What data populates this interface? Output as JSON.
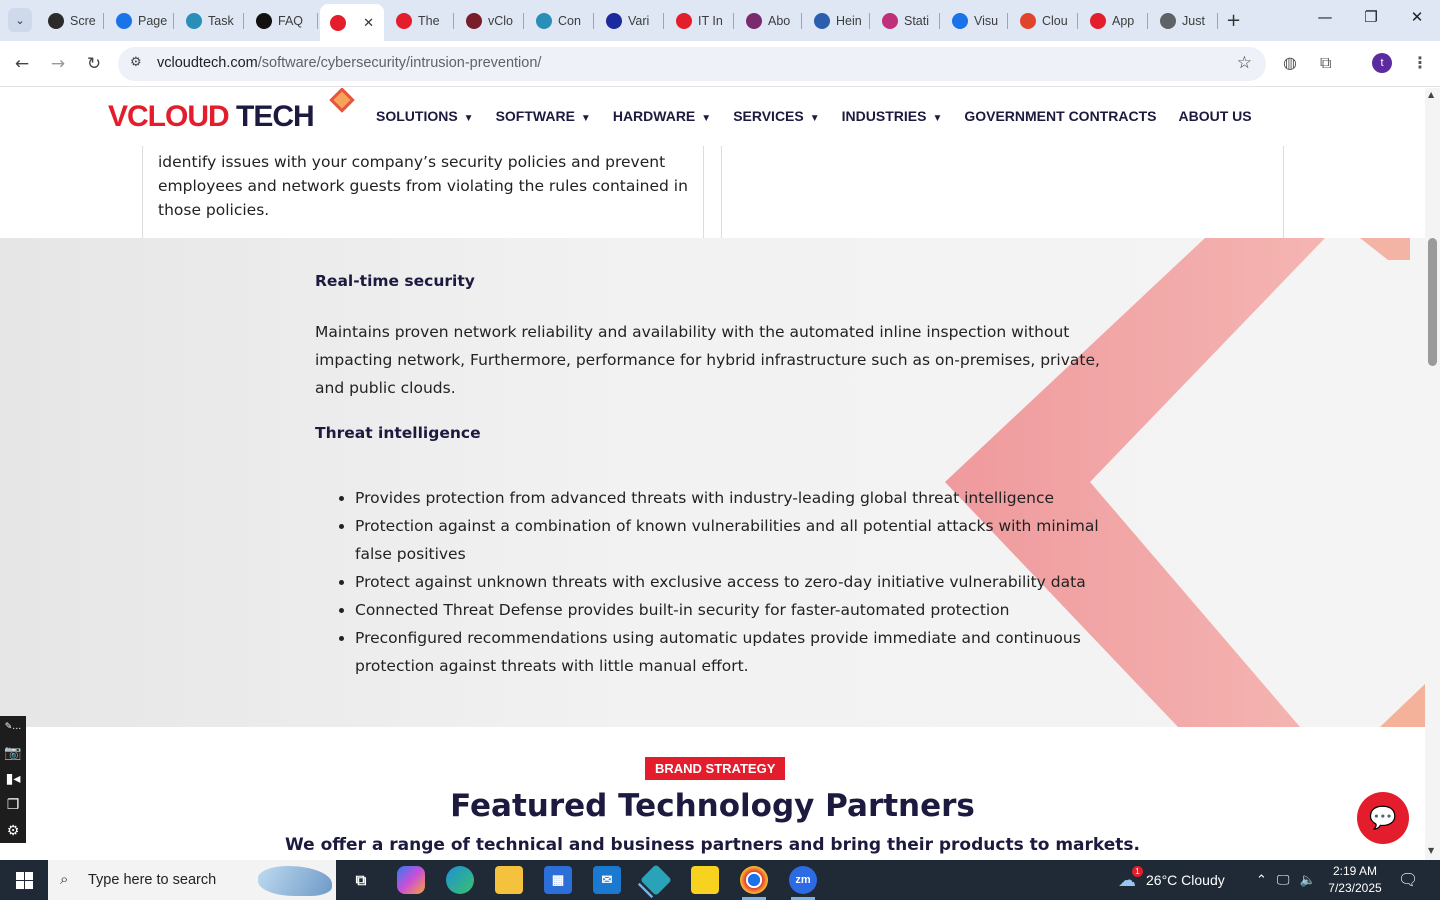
{
  "browser": {
    "tabs": [
      {
        "title": "Scre",
        "fav_color": "#2b2b2b",
        "icon": "screen-recorder-icon"
      },
      {
        "title": "Page",
        "fav_color": "#1a73e8",
        "icon": "gauge-icon"
      },
      {
        "title": "Task",
        "fav_color": "#2a8fb8",
        "icon": "hexagon-icon"
      },
      {
        "title": "FAQ",
        "fav_color": "#111111",
        "icon": "openai-icon"
      },
      {
        "title": "",
        "fav_color": "#e31d2b",
        "icon": "vcloud-icon",
        "active": true
      },
      {
        "title": "The",
        "fav_color": "#e31d2b",
        "icon": "vcloud-icon"
      },
      {
        "title": "vClo",
        "fav_color": "#7a1d2b",
        "icon": "v-icon"
      },
      {
        "title": "Con",
        "fav_color": "#2a8fb8",
        "icon": "hexagon-icon"
      },
      {
        "title": "Vari",
        "fav_color": "#1b2a9c",
        "icon": "x-icon"
      },
      {
        "title": "IT In",
        "fav_color": "#e31d2b",
        "icon": "vcloud-icon"
      },
      {
        "title": "Abo",
        "fav_color": "#7a2b6e",
        "icon": "circle-icon"
      },
      {
        "title": "Hein",
        "fav_color": "#2b5fae",
        "icon": "scale-icon"
      },
      {
        "title": "Stati",
        "fav_color": "#c0307a",
        "icon": "pen-icon"
      },
      {
        "title": "Visu",
        "fav_color": "#1a73e8",
        "icon": "pulse-icon"
      },
      {
        "title": "Clou",
        "fav_color": "#e0452b",
        "icon": "signature-icon"
      },
      {
        "title": "App",
        "fav_color": "#e31d2b",
        "icon": "vcloud-icon"
      },
      {
        "title": "Just",
        "fav_color": "#5f6368",
        "icon": "globe-icon"
      }
    ],
    "active_close": "✕",
    "new_tab": "+",
    "url_host": "vcloudtech.com",
    "url_path": "/software/cybersecurity/intrusion-prevention/",
    "profile_initial": "t"
  },
  "site": {
    "logo_v": "V",
    "logo_cloud": "CLOUD ",
    "logo_tech": "TECH",
    "nav": [
      {
        "label": "SOLUTIONS",
        "caret": true
      },
      {
        "label": "SOFTWARE",
        "caret": true
      },
      {
        "label": "HARDWARE",
        "caret": true
      },
      {
        "label": "SERVICES",
        "caret": true
      },
      {
        "label": "INDUSTRIES",
        "caret": true
      },
      {
        "label": "GOVERNMENT CONTRACTS",
        "caret": false
      },
      {
        "label": "ABOUT US",
        "caret": false
      }
    ],
    "card_text": "identify issues with your company’s security policies and prevent employees and network guests from violating the rules contained in those policies.",
    "realtime_heading": "Real-time security",
    "realtime_text": "Maintains proven network reliability and availability with the automated inline inspection without impacting network, Furthermore,  performance for hybrid infrastructure such as on-premises, private, and public clouds.",
    "threat_heading": "Threat intelligence",
    "threat_items": [
      "Provides protection from advanced threats with industry-leading global threat intelligence",
      "Protection against a combination of known vulnerabilities and all potential attacks with minimal false positives",
      "Protect against unknown threats with exclusive access to zero-day initiative vulnerability data",
      "Connected Threat Defense provides built-in security for faster-automated protection",
      "Preconfigured recommendations using automatic updates provide immediate and continuous protection against threats with little manual effort."
    ],
    "badge": "BRAND STRATEGY",
    "partners_title": "Featured Technology Partners",
    "partners_sub": "We offer a range of technical and business partners and bring their products to markets.",
    "accent": "#e31d2b",
    "navy": "#1c1a3e"
  },
  "taskbar": {
    "search_placeholder": "Type here to search",
    "weather": "26°C  Cloudy",
    "time": "2:19 AM",
    "date": "7/23/2025",
    "weather_badge": "1"
  }
}
